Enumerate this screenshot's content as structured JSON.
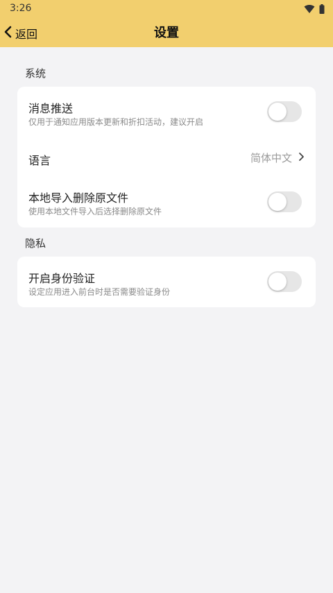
{
  "status_bar": {
    "time": "3:26",
    "icons": [
      "wifi-icon",
      "battery-icon"
    ]
  },
  "header": {
    "back_label": "返回",
    "title": "设置",
    "background_color": "#f2cf6e"
  },
  "sections": {
    "system": {
      "title": "系统",
      "push": {
        "title": "消息推送",
        "subtitle": "仅用于通知应用版本更新和折扣活动，建议开启",
        "enabled": false
      },
      "language": {
        "title": "语言",
        "value": "简体中文"
      },
      "delete_original": {
        "title": "本地导入删除原文件",
        "subtitle": "使用本地文件导入后选择删除原文件",
        "enabled": false
      }
    },
    "privacy": {
      "title": "隐私",
      "auth": {
        "title": "开启身份验证",
        "subtitle": "设定应用进入前台时是否需要验证身份",
        "enabled": false
      }
    }
  }
}
